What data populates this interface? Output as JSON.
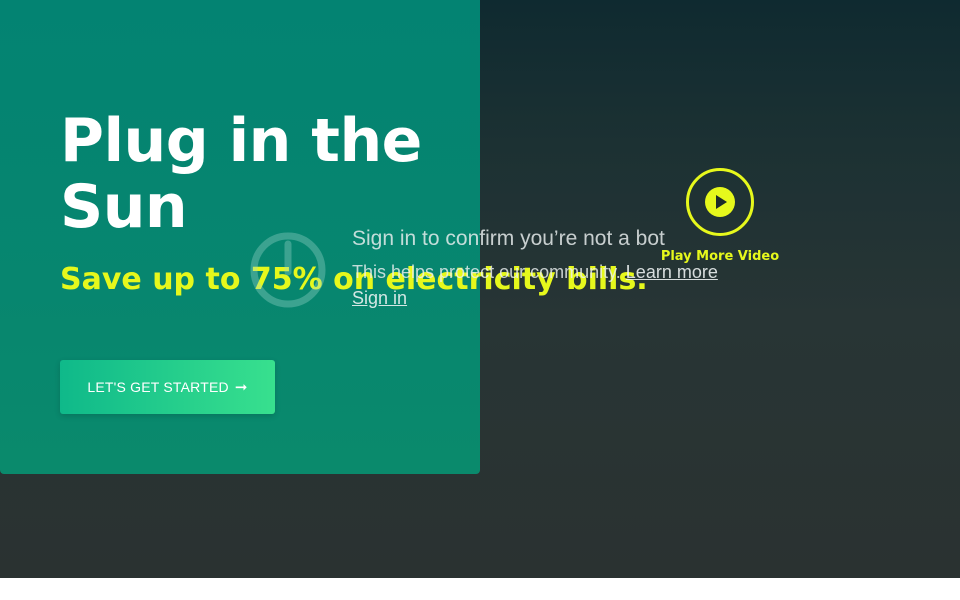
{
  "hero": {
    "headline": "Plug in the Sun",
    "subheadline": "Save up to 75% on electricity bills.",
    "cta_label": "LET'S GET STARTED",
    "cta_icon": "arrow-right-icon",
    "accent_color": "#e6f81c",
    "card_color": "#038372"
  },
  "video": {
    "icon": "play-icon",
    "label": "Play More Video"
  },
  "bot_check": {
    "icon": "power-icon",
    "title": "Sign in to confirm you’re not a bot",
    "description": "This helps protect our community.",
    "learn_more": "Learn more",
    "sign_in": "Sign in"
  }
}
